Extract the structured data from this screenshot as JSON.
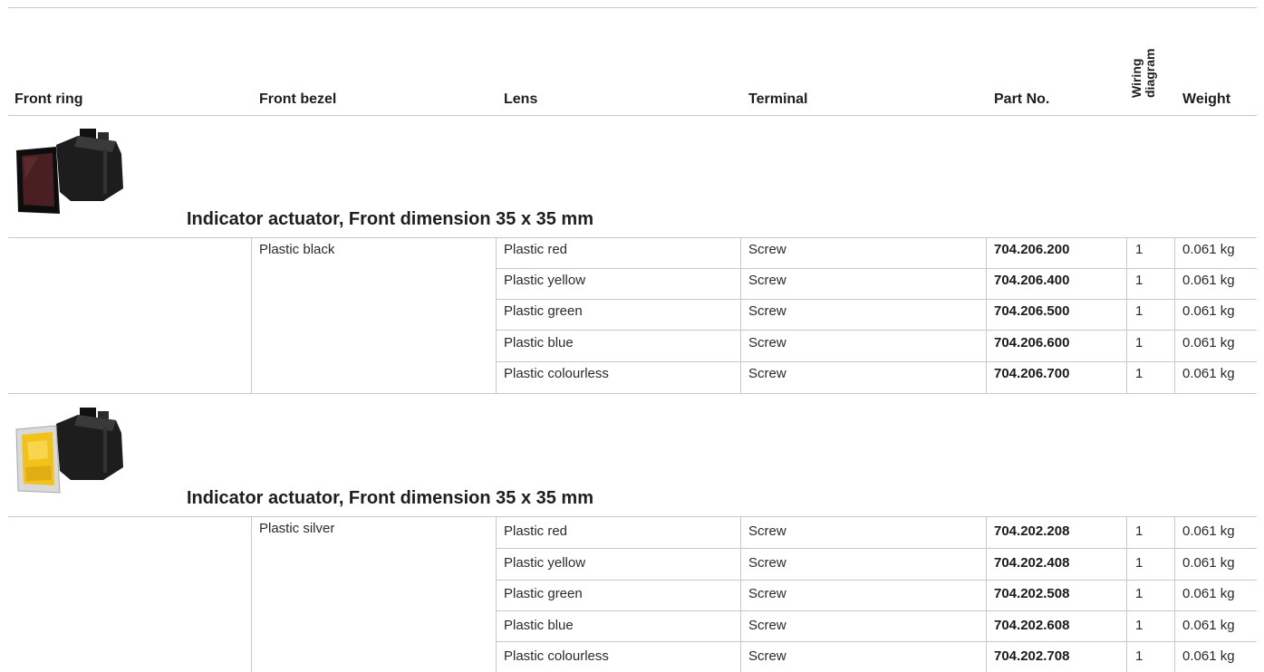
{
  "header": {
    "front_ring": "Front ring",
    "front_bezel": "Front bezel",
    "lens": "Lens",
    "terminal": "Terminal",
    "part_no": "Part No.",
    "wiring_diagram": "Wiring diagram",
    "weight": "Weight"
  },
  "sections": [
    {
      "title": "Indicator actuator, Front dimension 35 x 35 mm",
      "front_bezel": "Plastic black",
      "rows": [
        {
          "lens": "Plastic red",
          "terminal": "Screw",
          "part_no": "704.206.200",
          "wiring": "1",
          "weight": "0.061 kg"
        },
        {
          "lens": "Plastic yellow",
          "terminal": "Screw",
          "part_no": "704.206.400",
          "wiring": "1",
          "weight": "0.061 kg"
        },
        {
          "lens": "Plastic green",
          "terminal": "Screw",
          "part_no": "704.206.500",
          "wiring": "1",
          "weight": "0.061 kg"
        },
        {
          "lens": "Plastic blue",
          "terminal": "Screw",
          "part_no": "704.206.600",
          "wiring": "1",
          "weight": "0.061 kg"
        },
        {
          "lens": "Plastic colourless",
          "terminal": "Screw",
          "part_no": "704.206.700",
          "wiring": "1",
          "weight": "0.061 kg"
        }
      ]
    },
    {
      "title": "Indicator actuator, Front dimension 35 x 35 mm",
      "front_bezel": "Plastic silver",
      "rows": [
        {
          "lens": "Plastic red",
          "terminal": "Screw",
          "part_no": "704.202.208",
          "wiring": "1",
          "weight": "0.061 kg"
        },
        {
          "lens": "Plastic yellow",
          "terminal": "Screw",
          "part_no": "704.202.408",
          "wiring": "1",
          "weight": "0.061 kg"
        },
        {
          "lens": "Plastic green",
          "terminal": "Screw",
          "part_no": "704.202.508",
          "wiring": "1",
          "weight": "0.061 kg"
        },
        {
          "lens": "Plastic blue",
          "terminal": "Screw",
          "part_no": "704.202.608",
          "wiring": "1",
          "weight": "0.061 kg"
        },
        {
          "lens": "Plastic colourless",
          "terminal": "Screw",
          "part_no": "704.202.708",
          "wiring": "1",
          "weight": "0.061 kg"
        }
      ]
    }
  ],
  "colors": {
    "rule": "#c8c8c8",
    "black_lens": "#4a1f22",
    "yellow_lens": "#f2c21a",
    "silver_bezel": "#d9d9d9"
  }
}
